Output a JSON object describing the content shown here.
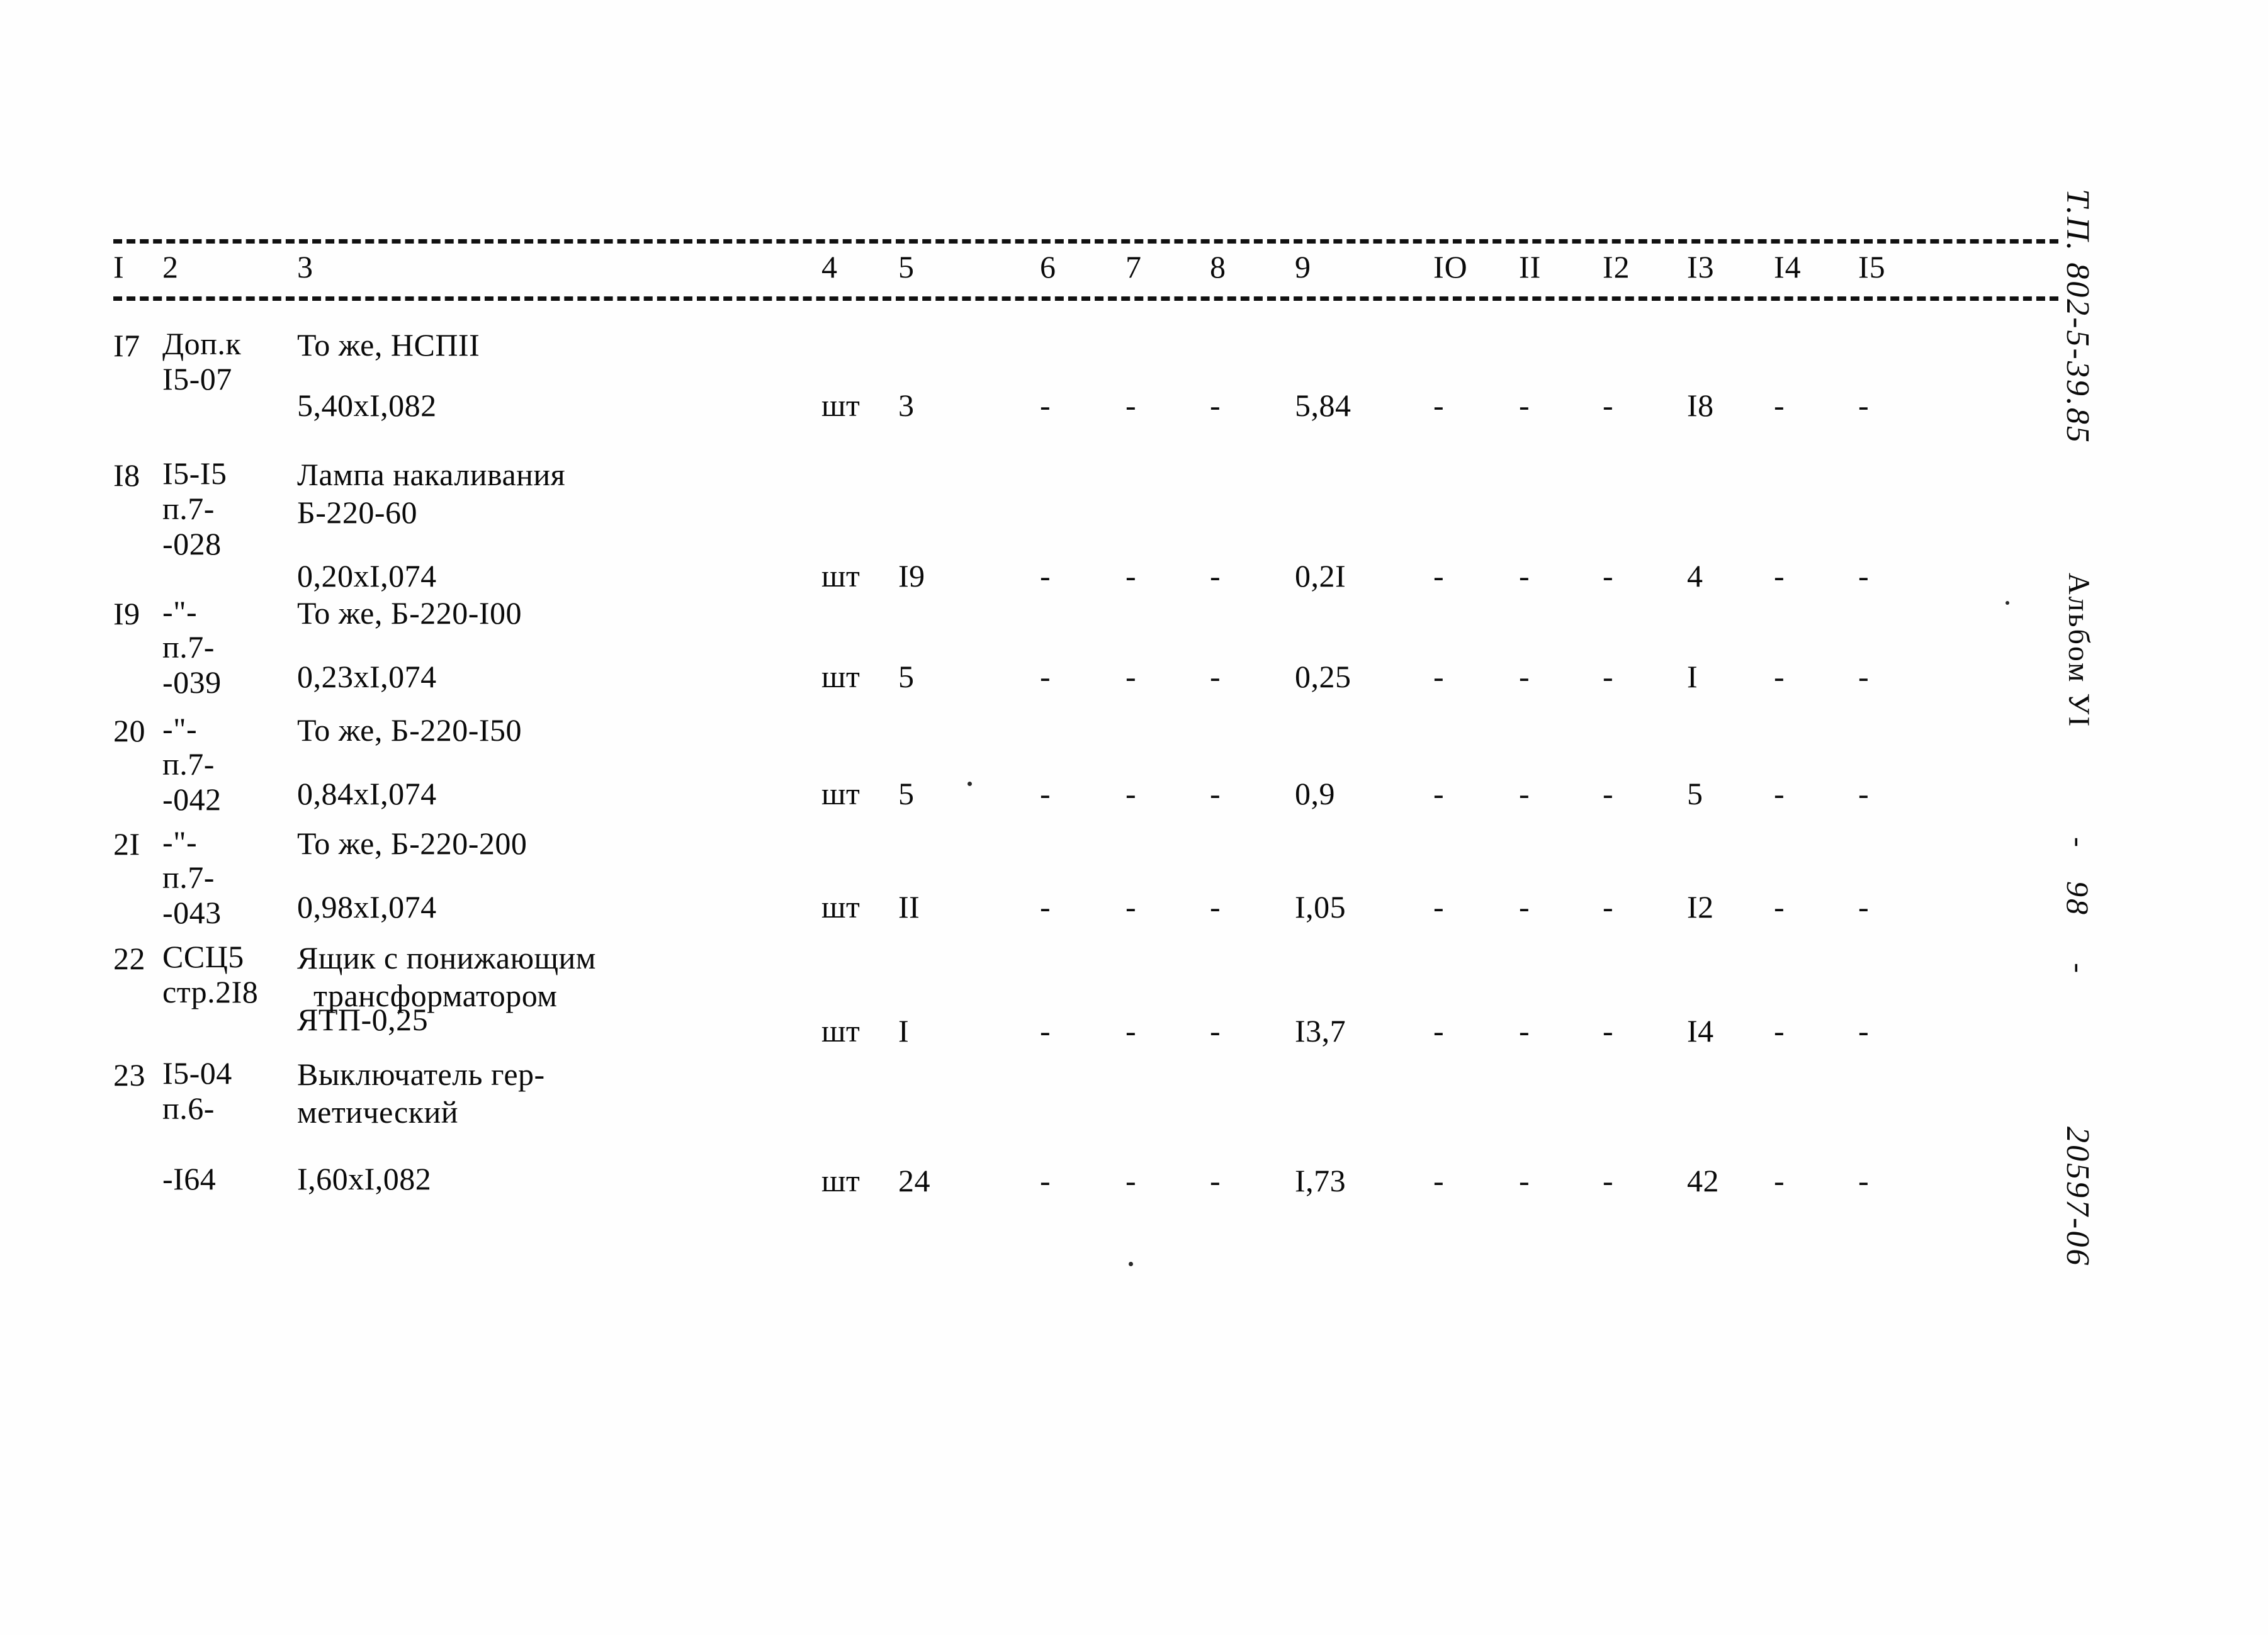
{
  "document": {
    "side_marks": {
      "type_project": "Т.П. 802-5-39.85",
      "album": "Альбом УI",
      "dash_upper": "-",
      "page_number": "98",
      "dash_lower": "-",
      "drawing_code": "20597-06"
    }
  },
  "table": {
    "headers": [
      "I",
      "2",
      "3",
      "4",
      "5",
      "6",
      "7",
      "8",
      "9",
      "IO",
      "II",
      "I2",
      "I3",
      "I4",
      "I5"
    ],
    "dash": "-",
    "rows": [
      {
        "c1": "I7",
        "c2": "Доп.к\nI5-07",
        "c3_desc": "То же, НСПІІ",
        "c3_size": "5,40хI,082",
        "c4": "шт",
        "c5": "3",
        "c6": "-",
        "c7": "-",
        "c8": "-",
        "c9": "5,84",
        "c10": "-",
        "c11": "-",
        "c12": "-",
        "c13": "I8",
        "c14": "-",
        "c15": "-"
      },
      {
        "c1": "I8",
        "c2": "I5-I5\nп.7-\n-028",
        "c3_desc": "Лампа накаливания\nБ-220-60",
        "c3_size": "0,20хI,074",
        "c4": "шт",
        "c5": "I9",
        "c6": "-",
        "c7": "-",
        "c8": "-",
        "c9": "0,2I",
        "c10": "-",
        "c11": "-",
        "c12": "-",
        "c13": "4",
        "c14": "-",
        "c15": "-"
      },
      {
        "c1": "I9",
        "c2": "-\"-\nп.7-\n-039",
        "c3_desc": "То же, Б-220-I00",
        "c3_size": "0,23хI,074",
        "c4": "шт",
        "c5": "5",
        "c6": "-",
        "c7": "-",
        "c8": "-",
        "c9": "0,25",
        "c10": "-",
        "c11": "-",
        "c12": "-",
        "c13": "I",
        "c14": "-",
        "c15": "-"
      },
      {
        "c1": "20",
        "c2": "-\"-\nп.7-\n-042",
        "c3_desc": "То же, Б-220-I50",
        "c3_size": "0,84хI,074",
        "c4": "шт",
        "c5": "5",
        "c6": "-",
        "c7": "-",
        "c8": "-",
        "c9": "0,9",
        "c10": "-",
        "c11": "-",
        "c12": "-",
        "c13": "5",
        "c14": "-",
        "c15": "-"
      },
      {
        "c1": "2I",
        "c2": "-\"-\nп.7-\n-043",
        "c3_desc": "То же, Б-220-200",
        "c3_size": "0,98хI,074",
        "c4": "шт",
        "c5": "II",
        "c6": "-",
        "c7": "-",
        "c8": "-",
        "c9": "I,05",
        "c10": "-",
        "c11": "-",
        "c12": "-",
        "c13": "I2",
        "c14": "-",
        "c15": "-"
      },
      {
        "c1": "22",
        "c2": "ССЦ5\nстр.2I8",
        "c3_desc": "Ящик с понижающим\n  трансформатором",
        "c3_size": "ЯТП-0,25",
        "c4": "шт",
        "c5": "I",
        "c6": "-",
        "c7": "-",
        "c8": "-",
        "c9": "I3,7",
        "c10": "-",
        "c11": "-",
        "c12": "-",
        "c13": "I4",
        "c14": "-",
        "c15": "-"
      },
      {
        "c1": "23",
        "c2": "I5-04\nп.6-\n\n-I64",
        "c3_desc": "Выключатель гер-\nметический",
        "c3_size": "I,60хI,082",
        "c4": "шт",
        "c5": "24",
        "c6": "-",
        "c7": "-",
        "c8": "-",
        "c9": "I,73",
        "c10": "-",
        "c11": "-",
        "c12": "-",
        "c13": "42",
        "c14": "-",
        "c15": "-"
      }
    ]
  }
}
